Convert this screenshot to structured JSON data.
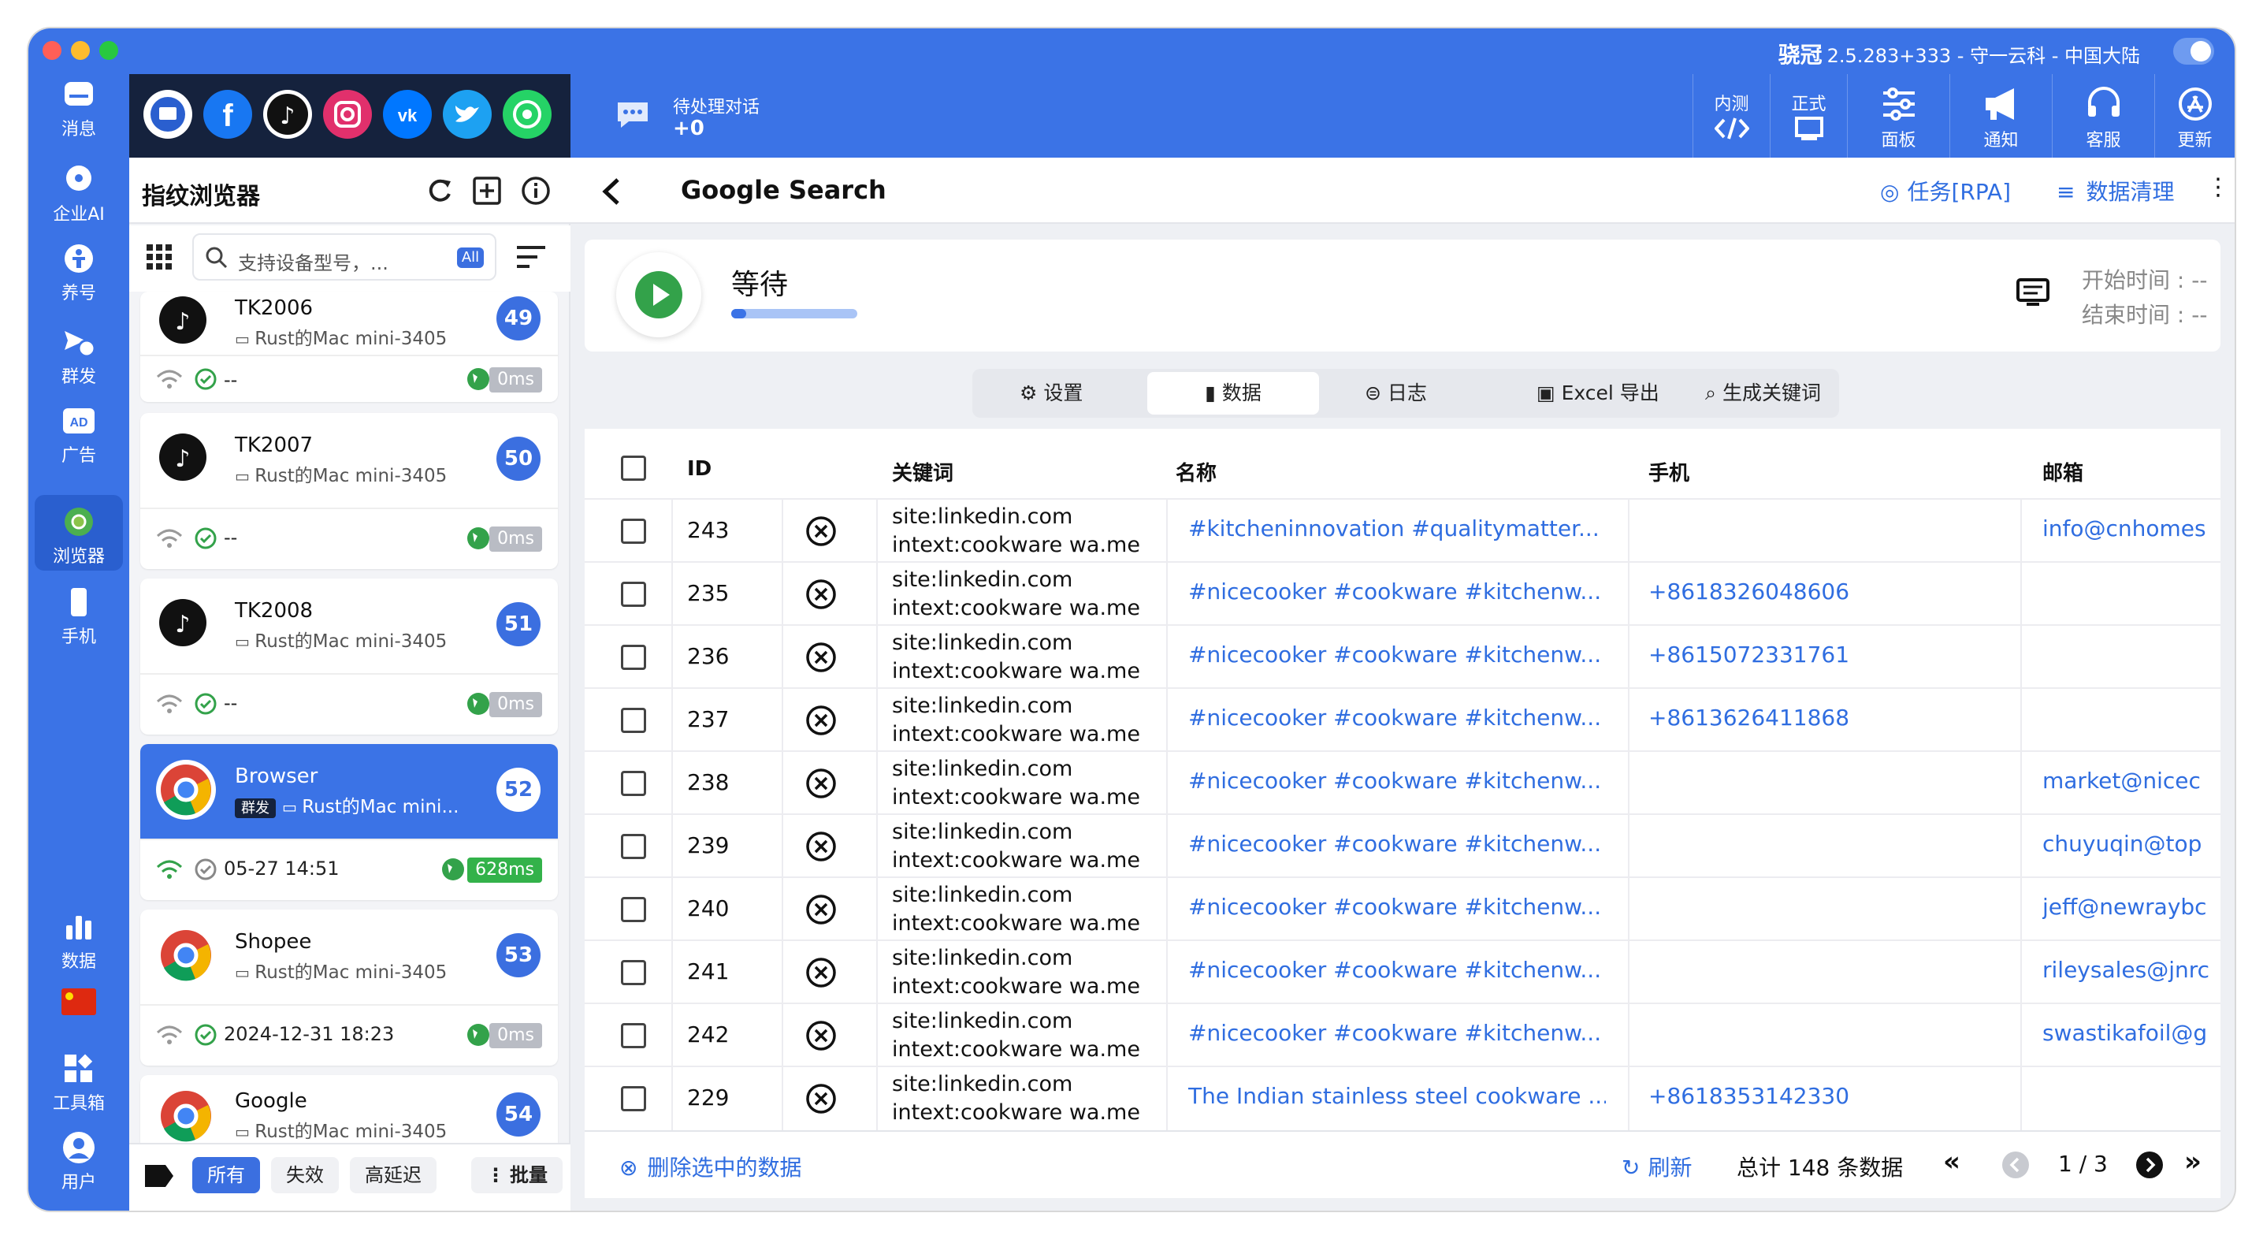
{
  "window": {
    "app_name": "骁冠",
    "title_rest": "2.5.283+333 - 守一云科 - 中国大陆"
  },
  "rail": {
    "items": [
      {
        "label": "消息"
      },
      {
        "label": "企业AI"
      },
      {
        "label": "养号"
      },
      {
        "label": "群发"
      },
      {
        "label": "广告"
      },
      {
        "label": "浏览器"
      },
      {
        "label": "手机"
      },
      {
        "label": "数据"
      },
      {
        "label": "工具箱"
      },
      {
        "label": "用户"
      }
    ]
  },
  "sidebar": {
    "title": "指纹浏览器",
    "search_placeholder": "支持设备型号，...",
    "search_badge": "All",
    "cards": [
      {
        "name": "TK2006",
        "device": "Rust的Mac mini-3405",
        "num": "49",
        "time": "--",
        "ms": "0ms"
      },
      {
        "name": "TK2007",
        "device": "Rust的Mac mini-3405",
        "num": "50",
        "time": "--",
        "ms": "0ms"
      },
      {
        "name": "TK2008",
        "device": "Rust的Mac mini-3405",
        "num": "51",
        "time": "--",
        "ms": "0ms"
      },
      {
        "name": "Browser",
        "tag": "群发",
        "device": "Rust的Mac mini...",
        "num": "52",
        "time": "05-27 14:51",
        "ms": "628ms"
      },
      {
        "name": "Shopee",
        "device": "Rust的Mac mini-3405",
        "num": "53",
        "time": "2024-12-31 18:23",
        "ms": "0ms"
      },
      {
        "name": "Google",
        "device": "Rust的Mac mini-3405",
        "num": "54"
      }
    ],
    "footer": {
      "all": "所有",
      "invalid": "失效",
      "high_latency": "高延迟",
      "batch": "批量"
    }
  },
  "topbar": {
    "pending_label": "待处理对话",
    "pending_count": "+0",
    "internal": "内测",
    "formal": "正式",
    "panel": "面板",
    "notify": "通知",
    "support": "客服",
    "update": "更新"
  },
  "page": {
    "title": "Google Search",
    "task_link": "任务[RPA]",
    "clean_link": "数据清理"
  },
  "status": {
    "state": "等待",
    "start_label": "开始时间 : --",
    "end_label": "结束时间 : --",
    "progress": 0.12
  },
  "tabs": {
    "settings": "设置",
    "data": "数据",
    "log": "日志",
    "excel": "Excel 导出",
    "keywords": "生成关键词"
  },
  "table": {
    "headers": {
      "id": "ID",
      "keyword": "关键词",
      "name": "名称",
      "phone": "手机",
      "email": "邮箱"
    },
    "rows": [
      {
        "id": "243",
        "kw1": "site:linkedin.com",
        "kw2": "intext:cookware wa.me",
        "name": "#kitcheninnovation #qualitymatter...",
        "phone": "",
        "email": "info@cnhomes"
      },
      {
        "id": "235",
        "kw1": "site:linkedin.com",
        "kw2": "intext:cookware wa.me",
        "name": "#nicecooker #cookware #kitchenw...",
        "phone": "+8618326048606",
        "email": ""
      },
      {
        "id": "236",
        "kw1": "site:linkedin.com",
        "kw2": "intext:cookware wa.me",
        "name": "#nicecooker #cookware #kitchenw...",
        "phone": "+8615072331761",
        "email": ""
      },
      {
        "id": "237",
        "kw1": "site:linkedin.com",
        "kw2": "intext:cookware wa.me",
        "name": "#nicecooker #cookware #kitchenw...",
        "phone": "+8613626411868",
        "email": ""
      },
      {
        "id": "238",
        "kw1": "site:linkedin.com",
        "kw2": "intext:cookware wa.me",
        "name": "#nicecooker #cookware #kitchenw...",
        "phone": "",
        "email": "market@nicec"
      },
      {
        "id": "239",
        "kw1": "site:linkedin.com",
        "kw2": "intext:cookware wa.me",
        "name": "#nicecooker #cookware #kitchenw...",
        "phone": "",
        "email": "chuyuqin@top"
      },
      {
        "id": "240",
        "kw1": "site:linkedin.com",
        "kw2": "intext:cookware wa.me",
        "name": "#nicecooker #cookware #kitchenw...",
        "phone": "",
        "email": "jeff@newraybc"
      },
      {
        "id": "241",
        "kw1": "site:linkedin.com",
        "kw2": "intext:cookware wa.me",
        "name": "#nicecooker #cookware #kitchenw...",
        "phone": "",
        "email": "rileysales@jnrc"
      },
      {
        "id": "242",
        "kw1": "site:linkedin.com",
        "kw2": "intext:cookware wa.me",
        "name": "#nicecooker #cookware #kitchenw...",
        "phone": "",
        "email": "swastikafoil@g"
      },
      {
        "id": "229",
        "kw1": "site:linkedin.com",
        "kw2": "intext:cookware wa.me",
        "name": "The Indian stainless steel cookware ...",
        "phone": "+8618353142330",
        "email": ""
      }
    ]
  },
  "footer": {
    "delete_selected": "删除选中的数据",
    "refresh": "刷新",
    "total": "总计 148 条数据",
    "page": "1 / 3"
  },
  "colors": {
    "brand": "#3b73e6",
    "link": "#2f6de0",
    "play": "#33a24a"
  }
}
